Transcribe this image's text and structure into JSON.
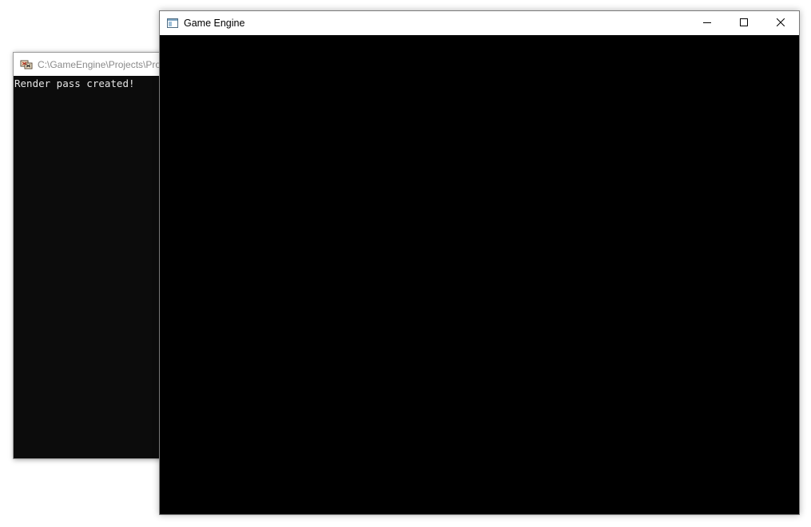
{
  "console_window": {
    "title": "C:\\GameEngine\\Projects\\Projects",
    "icon": "console-app-icon",
    "output_lines": [
      "Render pass created!"
    ],
    "background_color": "#0c0c0c",
    "text_color": "#e6e6e6"
  },
  "game_window": {
    "title": "Game Engine",
    "icon": "window-app-icon",
    "caption_buttons": {
      "minimize": "minimize-icon",
      "maximize": "maximize-icon",
      "close": "close-icon"
    },
    "viewport_color": "#000000"
  }
}
